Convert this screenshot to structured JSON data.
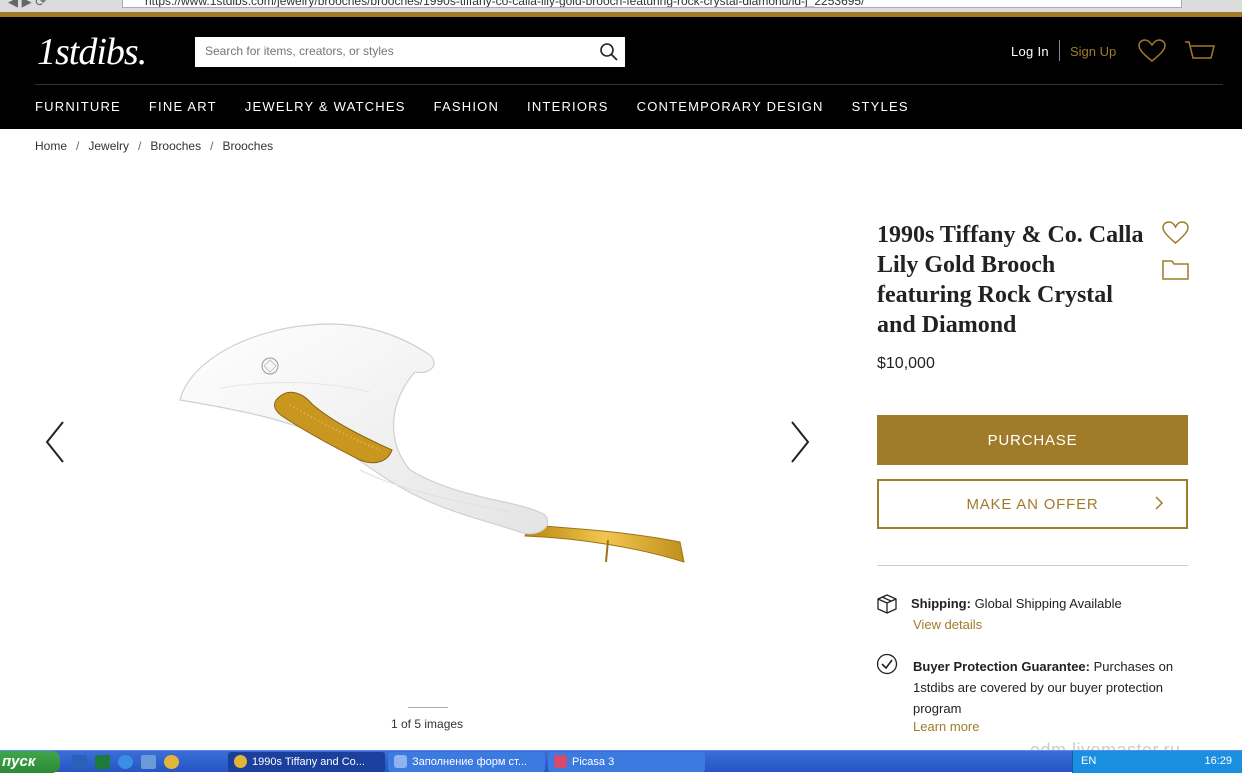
{
  "browser": {
    "url": "https://www.1stdibs.com/jewelry/brooches/brooches/1990s-tiffany-co-calla-lily-gold-brooch-featuring-rock-crystal-diamond/id-j_2253695/"
  },
  "header": {
    "logo": "1stdibs.",
    "search_placeholder": "Search for items, creators, or styles",
    "login": "Log In",
    "signup": "Sign Up",
    "accent": "#a07c2a"
  },
  "nav": {
    "items": [
      "FURNITURE",
      "FINE ART",
      "JEWELRY & WATCHES",
      "FASHION",
      "INTERIORS",
      "CONTEMPORARY DESIGN",
      "STYLES"
    ]
  },
  "breadcrumbs": [
    "Home",
    "Jewelry",
    "Brooches",
    "Brooches"
  ],
  "gallery": {
    "counter": "1 of 5 images"
  },
  "product": {
    "title": "1990s Tiffany & Co. Calla Lily Gold Brooch featuring Rock Crystal and Diamond",
    "price": "$10,000",
    "purchase_label": "PURCHASE",
    "offer_label": "MAKE AN OFFER"
  },
  "shipping": {
    "label": "Shipping:",
    "text": "Global Shipping Available",
    "link": "View details"
  },
  "buyer_protection": {
    "label": "Buyer Protection Guarantee:",
    "text": "Purchases on 1stdibs are covered by our buyer protection program",
    "link": "Learn more"
  },
  "taskbar": {
    "start": "пуск",
    "tasks": [
      "1990s Tiffany and Co...",
      "Заполнение форм ст...",
      "Picasa 3"
    ],
    "lang": "EN",
    "clock": "16:29"
  },
  "watermark": "odm.livemaster.ru"
}
